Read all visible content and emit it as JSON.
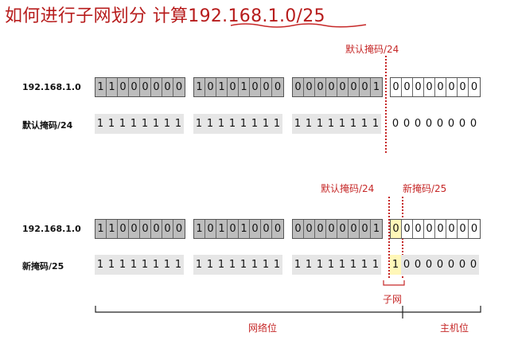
{
  "title": "如何进行子网划分 计算192.168.1.0/25",
  "section1": {
    "ip_label": "192.168.1.0",
    "mask_label": "默认掩码/24",
    "ip_groups": [
      "11000000",
      "10101000",
      "00000001",
      "00000000"
    ],
    "mask_groups": [
      "11111111",
      "11111111",
      "11111111",
      "00000000"
    ],
    "divider_label": "默认掩码/24"
  },
  "section2": {
    "ip_label": "192.168.1.0",
    "mask_label": "新掩码/25",
    "ip_groups": [
      "11000000",
      "10101000",
      "00000001",
      "00000000"
    ],
    "mask_groups": [
      "11111111",
      "11111111",
      "11111111",
      "10000000"
    ],
    "divider_label_old": "默认掩码/24",
    "divider_label_new": "新掩码/25",
    "subnet_label": "子网",
    "network_bits_label": "网络位",
    "host_bits_label": "主机位"
  },
  "colors": {
    "accent_red": "#c62828",
    "title_red": "#b71c1c",
    "highlight": "#fff7b8"
  }
}
